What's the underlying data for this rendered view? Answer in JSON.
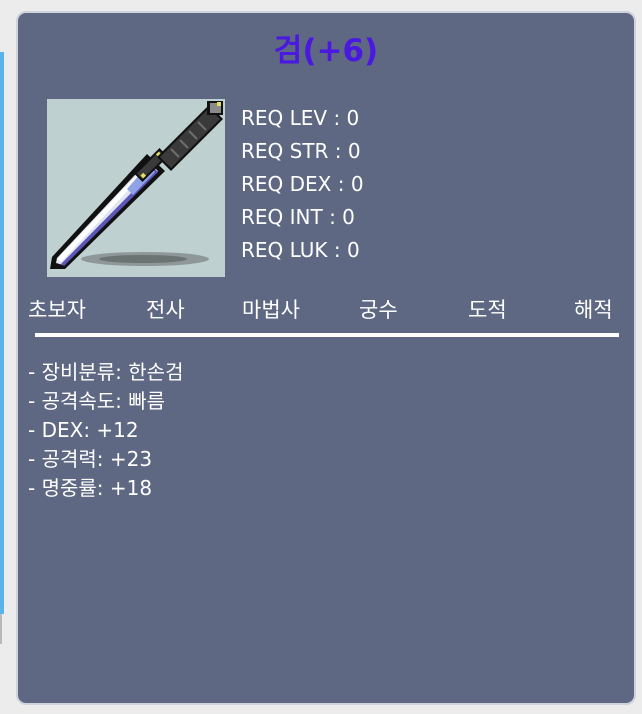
{
  "item": {
    "title": "검(+6)",
    "title_color": "#4a18e0",
    "image_icon": "sword-icon"
  },
  "requirements": [
    {
      "text": "REQ LEV : 0"
    },
    {
      "text": "REQ STR : 0"
    },
    {
      "text": "REQ DEX : 0"
    },
    {
      "text": "REQ INT : 0"
    },
    {
      "text": "REQ LUK : 0"
    }
  ],
  "jobs": [
    {
      "label": "초보자"
    },
    {
      "label": "전사"
    },
    {
      "label": "마법사"
    },
    {
      "label": "궁수"
    },
    {
      "label": "도적"
    },
    {
      "label": "해적"
    }
  ],
  "stats": [
    {
      "text": "- 장비분류: 한손검"
    },
    {
      "text": "- 공격속도: 빠름"
    },
    {
      "text": "- DEX: +12"
    },
    {
      "text": "- 공격력: +23"
    },
    {
      "text": "- 명중률: +18"
    }
  ],
  "colors": {
    "panel_background": "#5e6883",
    "text": "#ffffff",
    "image_background": "#bed0cf"
  }
}
